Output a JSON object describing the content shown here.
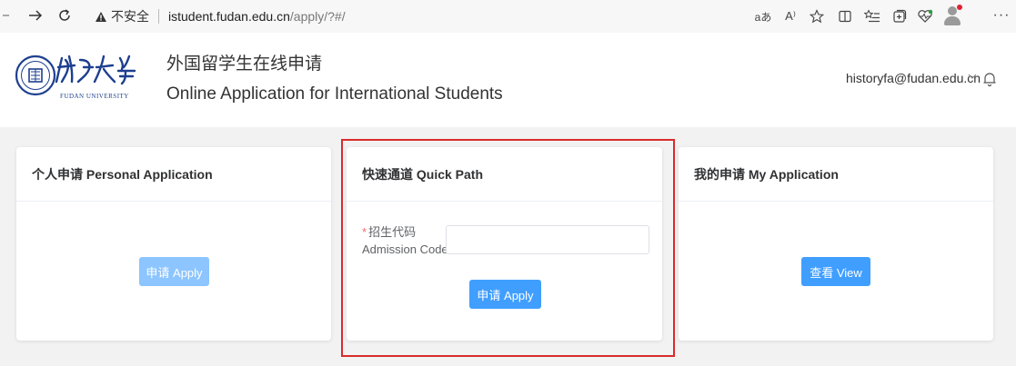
{
  "browser": {
    "insecure_label": "不安全",
    "url_host": "istudent.fudan.edu.cn",
    "url_path": "/apply/?#/",
    "read_aloud_glyph": "aあ",
    "text_size_glyph": "A⁾"
  },
  "header": {
    "title_cn": "外国留学生在线申请",
    "title_en": "Online Application for International Students",
    "user_email": "historyfa@fudan.edu.cn",
    "logo_text_en": "FUDAN UNIVERSITY"
  },
  "cards": {
    "personal": {
      "title": "个人申请 Personal Application",
      "apply_label": "申请 Apply"
    },
    "quick": {
      "title": "快速通道 Quick Path",
      "required_mark": "*",
      "code_label_cn": "招生代码",
      "code_label_en": "Admission Code",
      "code_value": "",
      "apply_label": "申请 Apply"
    },
    "mine": {
      "title": "我的申请 My Application",
      "view_label": "查看 View"
    }
  },
  "icons": {
    "back": "back-arrow-icon",
    "forward": "forward-arrow-icon",
    "refresh": "refresh-icon",
    "warning": "warning-icon",
    "favorite": "star-icon",
    "split": "split-screen-icon",
    "favorites_list": "favorites-list-icon",
    "collections": "collections-icon",
    "extension": "heart-pulse-icon",
    "profile": "profile-icon",
    "more": "more-icon",
    "bell": "bell-icon",
    "user_chevron": "chevron-down-icon"
  },
  "colors": {
    "primary": "#409eff",
    "primary_disabled": "#8cc5ff",
    "highlight": "#d92b2b",
    "required": "#f56c6c",
    "page_bg": "#f2f2f2"
  }
}
